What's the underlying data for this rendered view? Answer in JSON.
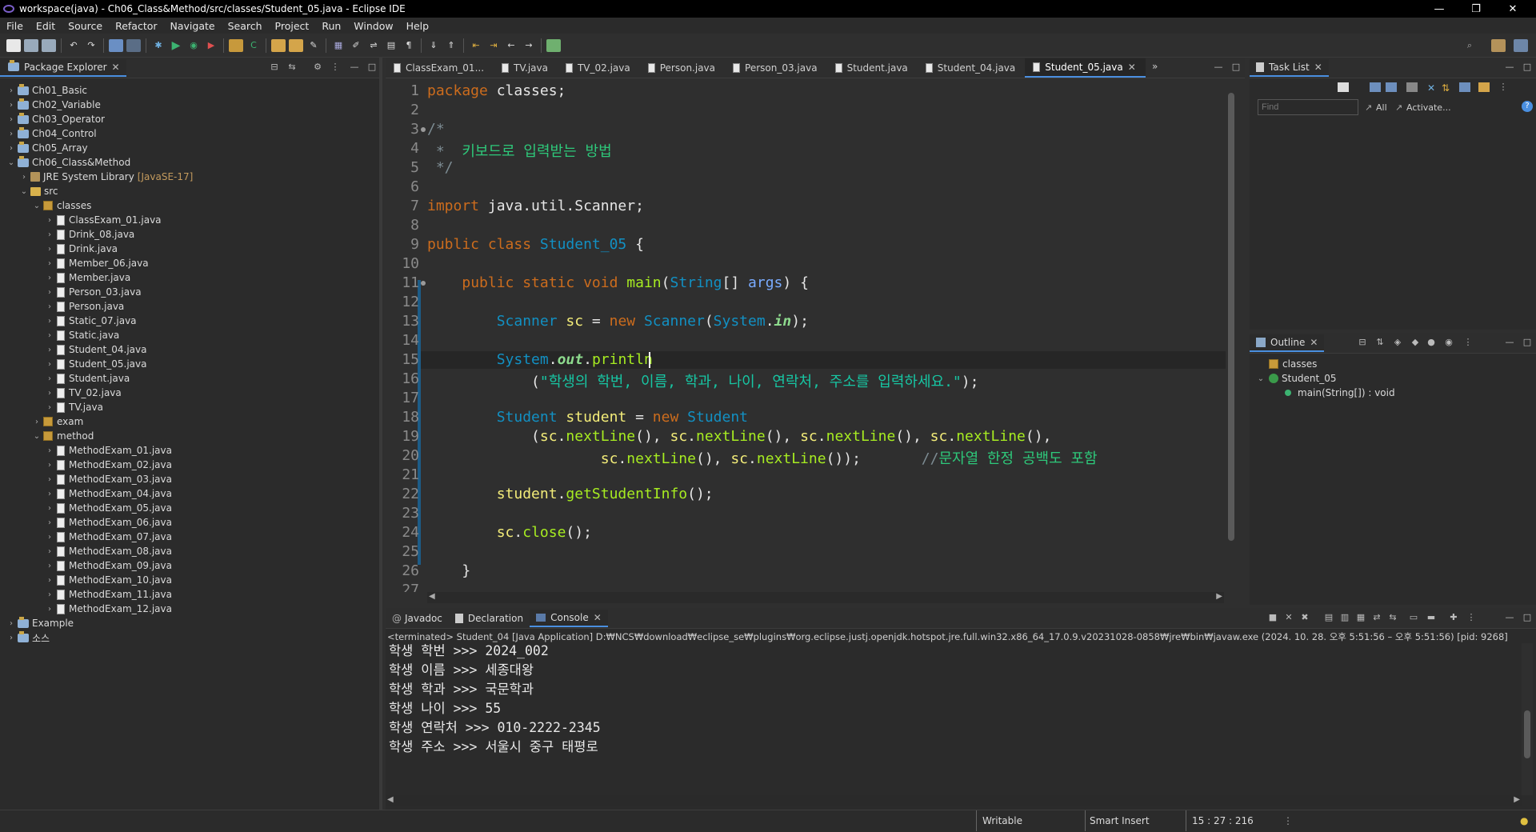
{
  "window": {
    "title": "workspace(java) - Ch06_Class&Method/src/classes/Student_05.java - Eclipse IDE",
    "controls": [
      "—",
      "❐",
      "✕"
    ]
  },
  "menu": [
    "File",
    "Edit",
    "Source",
    "Refactor",
    "Navigate",
    "Search",
    "Project",
    "Run",
    "Window",
    "Help"
  ],
  "package_explorer": {
    "title": "Package Explorer",
    "tree": [
      {
        "label": "Ch01_Basic",
        "icon": "project-icon",
        "depth": 0,
        "tw": "›"
      },
      {
        "label": "Ch02_Variable",
        "icon": "project-icon",
        "depth": 0,
        "tw": "›"
      },
      {
        "label": "Ch03_Operator",
        "icon": "project-icon",
        "depth": 0,
        "tw": "›"
      },
      {
        "label": "Ch04_Control",
        "icon": "project-icon",
        "depth": 0,
        "tw": "›"
      },
      {
        "label": "Ch05_Array",
        "icon": "project-icon",
        "depth": 0,
        "tw": "›"
      },
      {
        "label": "Ch06_Class&Method",
        "icon": "project-icon",
        "depth": 0,
        "tw": "⌄"
      },
      {
        "label": "JRE System Library",
        "decor": "[JavaSE-17]",
        "icon": "library-icon",
        "depth": 1,
        "tw": "›"
      },
      {
        "label": "src",
        "icon": "source-folder-icon",
        "depth": 1,
        "tw": "⌄"
      },
      {
        "label": "classes",
        "icon": "package-icon",
        "depth": 2,
        "tw": "⌄"
      },
      {
        "label": "ClassExam_01.java",
        "icon": "java-file-icon",
        "depth": 3,
        "tw": "›"
      },
      {
        "label": "Drink_08.java",
        "icon": "java-file-icon",
        "depth": 3,
        "tw": "›"
      },
      {
        "label": "Drink.java",
        "icon": "java-file-icon",
        "depth": 3,
        "tw": "›"
      },
      {
        "label": "Member_06.java",
        "icon": "java-file-icon",
        "depth": 3,
        "tw": "›"
      },
      {
        "label": "Member.java",
        "icon": "java-file-icon",
        "depth": 3,
        "tw": "›"
      },
      {
        "label": "Person_03.java",
        "icon": "java-file-icon",
        "depth": 3,
        "tw": "›"
      },
      {
        "label": "Person.java",
        "icon": "java-file-icon",
        "depth": 3,
        "tw": "›"
      },
      {
        "label": "Static_07.java",
        "icon": "java-file-icon",
        "depth": 3,
        "tw": "›"
      },
      {
        "label": "Static.java",
        "icon": "java-file-icon",
        "depth": 3,
        "tw": "›"
      },
      {
        "label": "Student_04.java",
        "icon": "java-file-icon",
        "depth": 3,
        "tw": "›"
      },
      {
        "label": "Student_05.java",
        "icon": "java-file-icon",
        "depth": 3,
        "tw": "›"
      },
      {
        "label": "Student.java",
        "icon": "java-file-icon",
        "depth": 3,
        "tw": "›"
      },
      {
        "label": "TV_02.java",
        "icon": "java-file-icon",
        "depth": 3,
        "tw": "›"
      },
      {
        "label": "TV.java",
        "icon": "java-file-icon",
        "depth": 3,
        "tw": "›"
      },
      {
        "label": "exam",
        "icon": "package-icon",
        "depth": 2,
        "tw": "›"
      },
      {
        "label": "method",
        "icon": "package-icon",
        "depth": 2,
        "tw": "⌄"
      },
      {
        "label": "MethodExam_01.java",
        "icon": "java-file-icon",
        "depth": 3,
        "tw": "›"
      },
      {
        "label": "MethodExam_02.java",
        "icon": "java-file-icon",
        "depth": 3,
        "tw": "›"
      },
      {
        "label": "MethodExam_03.java",
        "icon": "java-file-icon",
        "depth": 3,
        "tw": "›"
      },
      {
        "label": "MethodExam_04.java",
        "icon": "java-file-icon",
        "depth": 3,
        "tw": "›"
      },
      {
        "label": "MethodExam_05.java",
        "icon": "java-file-icon",
        "depth": 3,
        "tw": "›"
      },
      {
        "label": "MethodExam_06.java",
        "icon": "java-file-icon",
        "depth": 3,
        "tw": "›"
      },
      {
        "label": "MethodExam_07.java",
        "icon": "java-file-icon",
        "depth": 3,
        "tw": "›"
      },
      {
        "label": "MethodExam_08.java",
        "icon": "java-file-icon",
        "depth": 3,
        "tw": "›"
      },
      {
        "label": "MethodExam_09.java",
        "icon": "java-file-icon",
        "depth": 3,
        "tw": "›"
      },
      {
        "label": "MethodExam_10.java",
        "icon": "java-file-icon",
        "depth": 3,
        "tw": "›"
      },
      {
        "label": "MethodExam_11.java",
        "icon": "java-file-icon",
        "depth": 3,
        "tw": "›"
      },
      {
        "label": "MethodExam_12.java",
        "icon": "java-file-icon",
        "depth": 3,
        "tw": "›"
      },
      {
        "label": "Example",
        "icon": "project-icon",
        "depth": 0,
        "tw": "›"
      },
      {
        "label": "소스",
        "icon": "project-icon",
        "depth": 0,
        "tw": "›"
      }
    ]
  },
  "editor": {
    "tabs": [
      {
        "label": "ClassExam_01...",
        "active": false
      },
      {
        "label": "TV.java",
        "active": false
      },
      {
        "label": "TV_02.java",
        "active": false
      },
      {
        "label": "Person.java",
        "active": false
      },
      {
        "label": "Person_03.java",
        "active": false
      },
      {
        "label": "Student.java",
        "active": false
      },
      {
        "label": "Student_04.java",
        "active": false
      },
      {
        "label": "Student_05.java",
        "active": true
      }
    ],
    "overflow": "»",
    "current_line": 15,
    "lines": [
      [
        [
          "kw",
          "package"
        ],
        [
          "wh",
          " classes;"
        ]
      ],
      [],
      [
        [
          "cm",
          "/*"
        ]
      ],
      [
        [
          "cm",
          " *  "
        ],
        [
          "cmk",
          "키보드로 입력받는 방법"
        ]
      ],
      [
        [
          "cm",
          " */"
        ]
      ],
      [],
      [
        [
          "kw",
          "import"
        ],
        [
          "wh",
          " java.util.Scanner;"
        ]
      ],
      [],
      [
        [
          "kw",
          "public class"
        ],
        [
          "wh",
          " "
        ],
        [
          "ty",
          "Student_05"
        ],
        [
          "wh",
          " {"
        ]
      ],
      [],
      [
        [
          "wh",
          "    "
        ],
        [
          "kw",
          "public static void"
        ],
        [
          "wh",
          " "
        ],
        [
          "fn",
          "main"
        ],
        [
          "wh",
          "("
        ],
        [
          "ty",
          "String"
        ],
        [
          "wh",
          "[] "
        ],
        [
          "prm",
          "args"
        ],
        [
          "wh",
          ") {"
        ]
      ],
      [],
      [
        [
          "wh",
          "        "
        ],
        [
          "ty",
          "Scanner"
        ],
        [
          "wh",
          " "
        ],
        [
          "var",
          "sc"
        ],
        [
          "wh",
          " = "
        ],
        [
          "kw",
          "new"
        ],
        [
          "wh",
          " "
        ],
        [
          "ty",
          "Scanner"
        ],
        [
          "wh",
          "("
        ],
        [
          "ty",
          "System"
        ],
        [
          "wh",
          "."
        ],
        [
          "fld",
          "in"
        ],
        [
          "wh",
          ");"
        ]
      ],
      [],
      [
        [
          "wh",
          "        "
        ],
        [
          "ty",
          "System"
        ],
        [
          "wh",
          "."
        ],
        [
          "fld",
          "out"
        ],
        [
          "wh",
          "."
        ],
        [
          "fn",
          "println"
        ]
      ],
      [
        [
          "wh",
          "            ("
        ],
        [
          "st",
          "\"학생의 학번, 이름, 학과, 나이, 연락처, 주소를 입력하세요.\""
        ],
        [
          "wh",
          ");"
        ]
      ],
      [],
      [
        [
          "wh",
          "        "
        ],
        [
          "ty",
          "Student"
        ],
        [
          "wh",
          " "
        ],
        [
          "var",
          "student"
        ],
        [
          "wh",
          " = "
        ],
        [
          "kw",
          "new"
        ],
        [
          "wh",
          " "
        ],
        [
          "ty",
          "Student"
        ]
      ],
      [
        [
          "wh",
          "            ("
        ],
        [
          "var",
          "sc"
        ],
        [
          "wh",
          "."
        ],
        [
          "fn",
          "nextLine"
        ],
        [
          "wh",
          "(), "
        ],
        [
          "var",
          "sc"
        ],
        [
          "wh",
          "."
        ],
        [
          "fn",
          "nextLine"
        ],
        [
          "wh",
          "(), "
        ],
        [
          "var",
          "sc"
        ],
        [
          "wh",
          "."
        ],
        [
          "fn",
          "nextLine"
        ],
        [
          "wh",
          "(), "
        ],
        [
          "var",
          "sc"
        ],
        [
          "wh",
          "."
        ],
        [
          "fn",
          "nextLine"
        ],
        [
          "wh",
          "(),"
        ]
      ],
      [
        [
          "wh",
          "                    "
        ],
        [
          "var",
          "sc"
        ],
        [
          "wh",
          "."
        ],
        [
          "fn",
          "nextLine"
        ],
        [
          "wh",
          "(), "
        ],
        [
          "var",
          "sc"
        ],
        [
          "wh",
          "."
        ],
        [
          "fn",
          "nextLine"
        ],
        [
          "wh",
          "());       "
        ],
        [
          "cm",
          "//"
        ],
        [
          "cmk",
          "문자열 한정 공백도 포함"
        ]
      ],
      [],
      [
        [
          "wh",
          "        "
        ],
        [
          "var",
          "student"
        ],
        [
          "wh",
          "."
        ],
        [
          "fn",
          "getStudentInfo"
        ],
        [
          "wh",
          "();"
        ]
      ],
      [],
      [
        [
          "wh",
          "        "
        ],
        [
          "var",
          "sc"
        ],
        [
          "wh",
          "."
        ],
        [
          "fn",
          "close"
        ],
        [
          "wh",
          "();"
        ]
      ],
      [],
      [
        [
          "wh",
          "    }"
        ]
      ],
      []
    ]
  },
  "task_list": {
    "title": "Task List",
    "find_placeholder": "Find",
    "all_label": "All",
    "activate_label": "Activate..."
  },
  "outline": {
    "title": "Outline",
    "items": [
      "classes",
      "Student_05",
      "main(String[]) : void"
    ]
  },
  "bottom": {
    "tabs": [
      "Javadoc",
      "Declaration",
      "Console"
    ],
    "active_tab": "Console",
    "terminated": "<terminated> Student_04 [Java Application] D:₩NCS₩download₩eclipse_se₩plugins₩org.eclipse.justj.openjdk.hotspot.jre.full.win32.x86_64_17.0.9.v20231028-0858₩jre₩bin₩javaw.exe  (2024. 10. 28. 오후 5:51:56 – 오후 5:51:56) [pid: 9268]",
    "output": [
      "학생 학번 >>> 2024_002",
      "학생 이름 >>> 세종대왕",
      "학생 학과 >>> 국문학과",
      "학생 나이 >>> 55",
      "학생 연락처 >>> 010-2222-2345",
      "학생 주소 >>> 서울시 중구 태평로"
    ]
  },
  "status": {
    "writable": "Writable",
    "insert_mode": "Smart Insert",
    "position": "15 : 27 : 216"
  }
}
